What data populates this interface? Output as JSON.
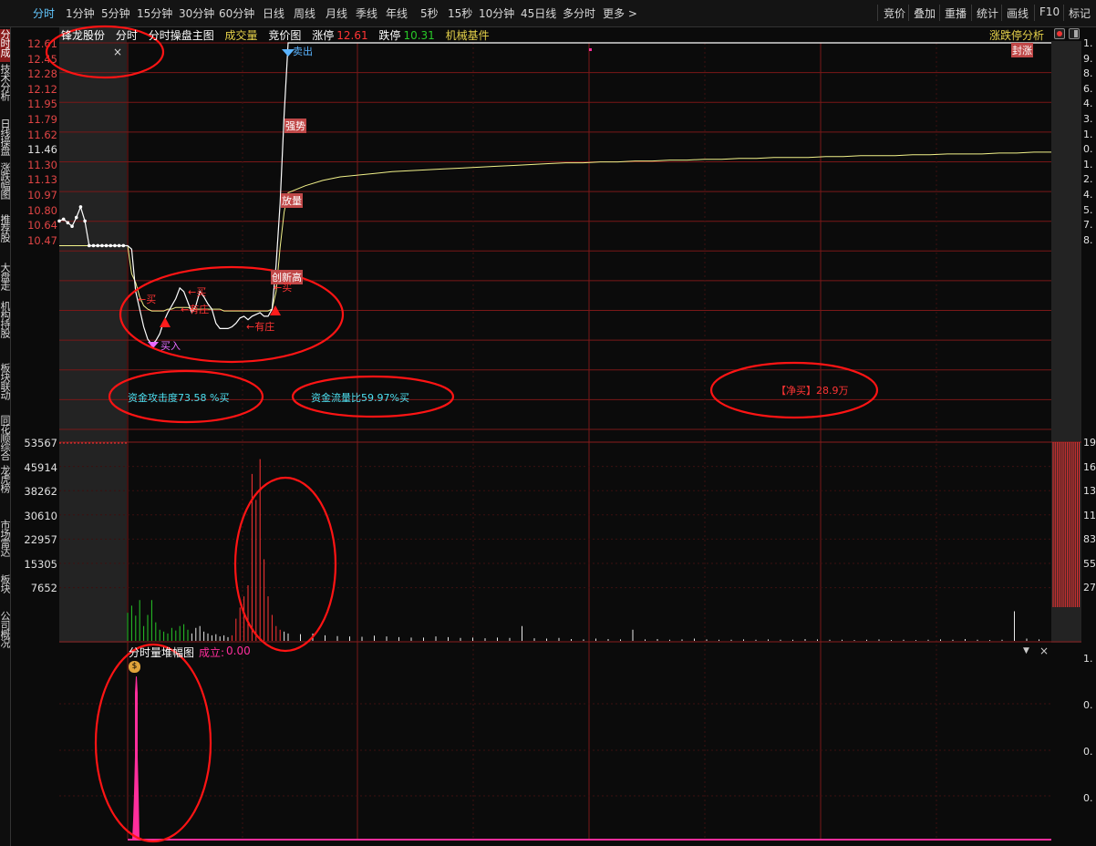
{
  "toolbar": {
    "periods": [
      "分时",
      "1分钟",
      "5分钟",
      "15分钟",
      "30分钟",
      "60分钟",
      "日线",
      "周线",
      "月线",
      "季线",
      "年线",
      "5秒",
      "15秒",
      "10分钟",
      "45日线",
      "多分时",
      "更多"
    ],
    "active_period": "分时",
    "right_buttons": [
      "竞价",
      "叠加",
      "重播",
      "统计",
      "画线",
      "F10",
      "标记"
    ]
  },
  "side_tabs": [
    "分时成交",
    "技术分析",
    "日线操盘",
    "涨跌幅图",
    "推荐股",
    "大盘走势",
    "机构持股",
    "板块联动",
    "同花顺综合",
    "龙虎榜",
    "市场雷达",
    "板块",
    "公司概况"
  ],
  "infobar": {
    "stock_name": "锋龙股份",
    "mode1": "分时",
    "mode2": "分时操盘主图",
    "volume_label": "成交量",
    "auction_label": "竞价图",
    "limit_up_label": "涨停",
    "limit_up_value": "12.61",
    "limit_down_label": "跌停",
    "limit_down_value": "10.31",
    "sector": "机械基件",
    "right_label": "涨跌停分析"
  },
  "price_axis": [
    "12.61",
    "12.45",
    "12.28",
    "12.12",
    "11.95",
    "11.79",
    "11.62",
    "11.46",
    "11.30",
    "11.13",
    "10.97",
    "10.80",
    "10.64",
    "10.47"
  ],
  "volume_axis": [
    "53567",
    "45914",
    "38262",
    "30610",
    "22957",
    "15305",
    "7652"
  ],
  "right_axis_price": [
    "1.",
    "9.",
    "8.",
    "6.",
    "4.",
    "3.",
    "1.",
    "0.",
    "1.",
    "2.",
    "4.",
    "5.",
    "7.",
    "8."
  ],
  "right_axis_volume": [
    "19",
    "16",
    "13",
    "11",
    "83",
    "55",
    "27"
  ],
  "right_axis_lower": [
    "1.",
    "0.",
    "0.",
    "0."
  ],
  "annotations": {
    "sell_mark": "卖出",
    "strong": "强势",
    "volume_up": "放量",
    "new_high": "创新高",
    "buy_arrow1": "←买",
    "buy_arrow2": "←买",
    "buy_arrow3": "←买",
    "has_banker1": "←有庄",
    "has_banker2": "←有庄",
    "buy_in": "买入",
    "seal": "封涨"
  },
  "metrics": {
    "attack": "资金攻击度73.58 %买",
    "flow": "资金流量比59.97%买",
    "net_buy": "【净买】28.9万"
  },
  "lower_panel": {
    "title": "分时量堆幅图",
    "deal_label": "成立:",
    "deal_value": "0.00"
  },
  "colors": {
    "up": "#ff3434",
    "down": "#28c828",
    "price_line": "#ffffff",
    "avg_line": "#f2f28a",
    "cyan": "#4ee0f0",
    "magenta": "#ff2e9c",
    "circle": "#ff1414"
  },
  "chart_data": {
    "type": "line",
    "series": [
      {
        "name": "",
        "values": [
          11.6,
          11.61,
          11.59,
          11.57,
          11.62,
          11.68,
          11.6,
          11.46,
          11.46,
          11.46,
          11.46,
          11.46,
          11.46,
          11.46,
          11.46,
          11.46,
          11.46,
          11.44,
          11.2,
          11.1,
          11.0,
          10.93,
          10.9,
          10.92,
          10.96,
          11.03,
          11.08,
          11.12,
          11.16,
          11.22,
          11.2,
          11.14,
          11.08,
          11.12,
          11.2,
          11.17,
          11.13,
          11.1,
          11.02,
          10.99,
          10.99,
          10.99,
          11.0,
          11.02,
          11.05,
          11.06,
          11.04,
          11.06,
          11.07,
          11.08,
          11.06,
          11.06,
          11.1,
          11.35,
          11.7,
          12.2,
          12.61,
          12.61,
          12.61,
          12.61,
          12.61,
          12.61,
          12.61,
          12.61,
          12.61,
          12.61,
          12.61,
          12.61,
          12.61,
          12.61,
          12.61,
          12.61,
          12.61,
          12.61,
          12.61,
          12.61,
          12.61,
          12.61,
          12.61,
          12.61,
          12.61,
          12.61,
          12.61,
          12.61,
          12.61,
          12.61,
          12.61,
          12.61,
          12.61,
          12.61,
          12.61,
          12.61,
          12.61,
          12.61,
          12.61,
          12.61,
          12.61,
          12.61,
          12.61,
          12.61,
          12.61
        ]
      },
      {
        "name": "",
        "values": [
          11.46,
          11.46,
          11.46,
          11.46,
          11.46,
          11.46,
          11.46,
          11.46,
          11.46,
          11.46,
          11.46,
          11.46,
          11.46,
          11.46,
          11.46,
          11.46,
          11.46,
          11.3,
          11.25,
          11.17,
          11.12,
          11.1,
          11.09,
          11.09,
          11.09,
          11.09,
          11.1,
          11.1,
          11.11,
          11.11,
          11.11,
          11.11,
          11.1,
          11.1,
          11.1,
          11.1,
          11.1,
          11.1,
          11.1,
          11.1,
          11.09,
          11.09,
          11.09,
          11.09,
          11.09,
          11.09,
          11.09,
          11.09,
          11.09,
          11.09,
          11.09,
          11.09,
          11.1,
          11.2,
          11.45,
          11.65,
          11.76,
          11.8,
          11.83,
          11.85,
          11.86,
          11.87,
          11.88,
          11.885,
          11.89,
          11.895,
          11.9,
          11.905,
          11.91,
          11.915,
          11.92,
          11.925,
          11.93,
          11.93,
          11.935,
          11.935,
          11.94,
          11.94,
          11.945,
          11.945,
          11.95,
          11.95,
          11.955,
          11.955,
          11.96,
          11.96,
          11.96,
          11.965,
          11.965,
          11.97,
          11.97,
          11.97,
          11.975,
          11.975,
          11.98,
          11.98,
          11.98,
          11.985,
          11.985,
          11.99,
          11.99
        ]
      }
    ],
    "ylim": [
      10.47,
      12.61
    ],
    "volume": [
      7600,
      9500,
      6800,
      11000,
      4000,
      7000,
      11000,
      5000,
      3000,
      2500,
      2000,
      3500,
      2800,
      4000,
      4500,
      3000,
      2000,
      3500,
      4000,
      2500,
      2000,
      1500,
      1800,
      1200,
      1500,
      1000,
      1500,
      6000,
      9000,
      12000,
      15000,
      45000,
      38000,
      49000,
      22000,
      12000,
      7000,
      4000,
      3000,
      2500,
      2000,
      1800,
      2000,
      1500,
      1300,
      1200,
      1100,
      1400,
      1200,
      1000,
      900,
      900,
      1200,
      1000,
      800,
      900,
      700,
      900,
      800,
      4000,
      700,
      600,
      800,
      500,
      400,
      600,
      500,
      400,
      3000,
      400,
      500,
      300,
      400,
      600,
      400,
      300,
      300,
      400,
      300,
      400,
      300,
      300,
      500,
      400,
      300,
      300,
      200,
      300,
      400,
      200,
      300,
      200,
      300,
      400,
      300,
      500,
      300,
      200,
      300,
      8000,
      600,
      400
    ],
    "volume_colors_green_first": 16,
    "vol_max": 53567
  }
}
